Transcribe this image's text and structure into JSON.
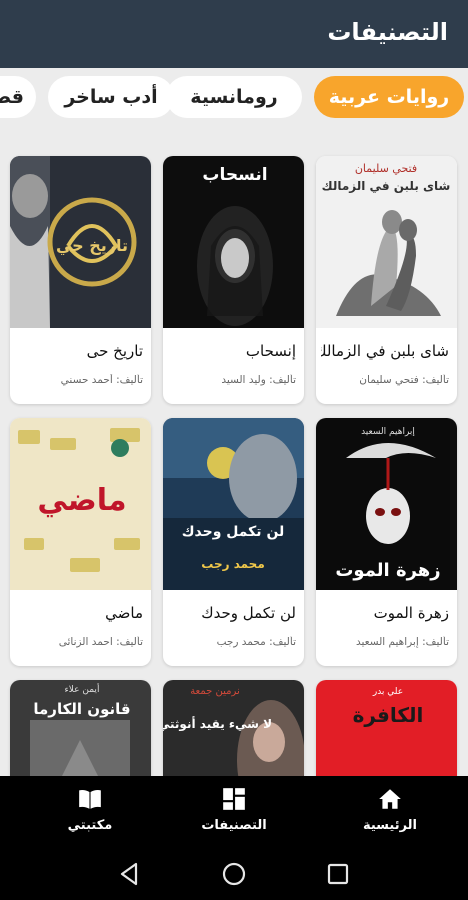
{
  "header": {
    "title": "التصنيفات"
  },
  "chips": [
    {
      "label": "روايات عربية",
      "active": true
    },
    {
      "label": "رومانسية",
      "active": false
    },
    {
      "label": "أدب ساخر",
      "active": false
    },
    {
      "label": "قصص",
      "active": false
    }
  ],
  "books": [
    {
      "title": "شاى بلبن في الزمالك",
      "author": "تأليف: فتحي سليمان",
      "cover_text": "شاى بلبن في الزمالك",
      "cover_author": "فتحي سليمان"
    },
    {
      "title": "إنسحاب",
      "author": "تأليف: وليد السيد",
      "cover_text": "انسحاب",
      "cover_author": ""
    },
    {
      "title": "تاريخ حى",
      "author": "تأليف: أحمد حسني",
      "cover_text": "تاريخ حي",
      "cover_author": ""
    },
    {
      "title": "زهرة الموت",
      "author": "تأليف: إبراهيم السعيد",
      "cover_text": "زهرة الموت",
      "cover_author": "إبراهيم السعيد"
    },
    {
      "title": "لن تكمل وحدك",
      "author": "تأليف: محمد رجب",
      "cover_text": "لن تكمل وحدك",
      "cover_author": "محمد رجب"
    },
    {
      "title": "ماضي",
      "author": "تأليف: احمد الزنائى",
      "cover_text": "ماضي",
      "cover_author": ""
    },
    {
      "title": "",
      "author": "",
      "cover_text": "الكافرة",
      "cover_author": "علي بدر"
    },
    {
      "title": "",
      "author": "",
      "cover_text": "لا شيء يقيد أنوثتي",
      "cover_author": "نرمين جمعة"
    },
    {
      "title": "",
      "author": "",
      "cover_text": "قانون الكارما",
      "cover_author": "أيمن علاء"
    }
  ],
  "nav": [
    {
      "label": "الرئيسية",
      "icon": "home-icon"
    },
    {
      "label": "التصنيفات",
      "icon": "categories-icon"
    },
    {
      "label": "مكتبتي",
      "icon": "book-icon"
    }
  ],
  "colors": {
    "appbar": "#2f3d4c",
    "accent": "#f8a52c",
    "background": "#ececec"
  }
}
